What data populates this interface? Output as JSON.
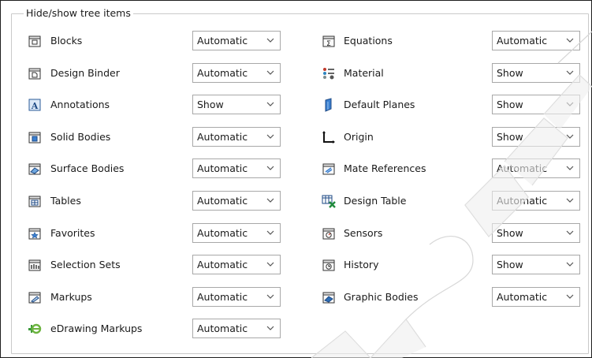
{
  "group": {
    "title": "Hide/show tree items"
  },
  "left_items": [
    {
      "label": "Blocks",
      "value": "Automatic",
      "icon": "blocks-icon"
    },
    {
      "label": "Design Binder",
      "value": "Automatic",
      "icon": "design-binder-icon"
    },
    {
      "label": "Annotations",
      "value": "Show",
      "icon": "annotations-icon"
    },
    {
      "label": "Solid Bodies",
      "value": "Automatic",
      "icon": "solid-bodies-icon"
    },
    {
      "label": "Surface Bodies",
      "value": "Automatic",
      "icon": "surface-bodies-icon"
    },
    {
      "label": "Tables",
      "value": "Automatic",
      "icon": "tables-icon"
    },
    {
      "label": "Favorites",
      "value": "Automatic",
      "icon": "favorites-icon"
    },
    {
      "label": "Selection Sets",
      "value": "Automatic",
      "icon": "selection-sets-icon"
    },
    {
      "label": "Markups",
      "value": "Automatic",
      "icon": "markups-icon"
    },
    {
      "label": "eDrawing Markups",
      "value": "Automatic",
      "icon": "edrawing-markups-icon"
    }
  ],
  "right_items": [
    {
      "label": "Equations",
      "value": "Automatic",
      "icon": "equations-icon"
    },
    {
      "label": "Material",
      "value": "Show",
      "icon": "material-icon"
    },
    {
      "label": "Default Planes",
      "value": "Show",
      "icon": "default-planes-icon"
    },
    {
      "label": "Origin",
      "value": "Show",
      "icon": "origin-icon"
    },
    {
      "label": "Mate References",
      "value": "Automatic",
      "icon": "mate-references-icon"
    },
    {
      "label": "Design Table",
      "value": "Automatic",
      "icon": "design-table-icon"
    },
    {
      "label": "Sensors",
      "value": "Show",
      "icon": "sensors-icon"
    },
    {
      "label": "History",
      "value": "Show",
      "icon": "history-icon"
    },
    {
      "label": "Graphic Bodies",
      "value": "Automatic",
      "icon": "graphic-bodies-icon"
    }
  ],
  "watermark_text": "REPRODUCTION"
}
